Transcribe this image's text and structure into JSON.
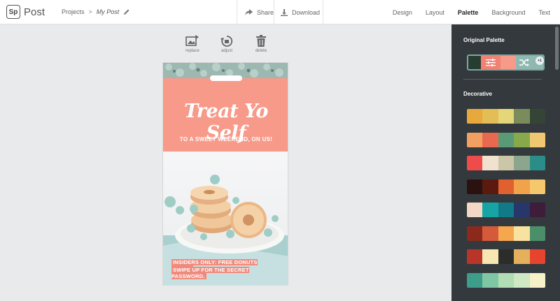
{
  "app": {
    "logo_mark": "Sp",
    "name": "Post"
  },
  "breadcrumb": {
    "projects": "Projects",
    "separator": ">",
    "current": "My Post"
  },
  "actions": {
    "share": "Share",
    "download": "Download"
  },
  "tabs": [
    {
      "label": "Design",
      "active": false
    },
    {
      "label": "Layout",
      "active": false
    },
    {
      "label": "Palette",
      "active": true
    },
    {
      "label": "Background",
      "active": false
    },
    {
      "label": "Text",
      "active": false
    }
  ],
  "tools": {
    "replace": "replace",
    "adjust": "adjust",
    "delete": "delete"
  },
  "poster": {
    "headline": "Treat Yo Self",
    "subhead": "TO A SWEET WEEKEND, ON US!",
    "caption_line1": "INSIDERS ONLY: FREE DONUTS TODAY!",
    "caption_line2": "SWIPE UP FOR THE SECRET PASSWORD."
  },
  "panel": {
    "original_palette_title": "Original Palette",
    "original_colors": [
      "#283d32",
      "#ef8273",
      "#f79a8a",
      "#f79a8a",
      "#8fb8b3"
    ],
    "badge": "+1",
    "decorative_title": "Decorative",
    "palettes": [
      [
        "#e7a93b",
        "#e3bd55",
        "#e6d67a",
        "#7b8c5c",
        "#354535"
      ],
      [
        "#f1a062",
        "#e8694f",
        "#5a9a77",
        "#87a94b",
        "#f0c871"
      ],
      [
        "#ee4b4b",
        "#f0e2cf",
        "#ccc6a8",
        "#8ba68c",
        "#2a8d88"
      ],
      [
        "#2a1210",
        "#5a1a10",
        "#e0602f",
        "#f1a24a",
        "#f5c86d"
      ],
      [
        "#f4d6c6",
        "#17a4a4",
        "#127a86",
        "#27376b",
        "#3d1d3a"
      ],
      [
        "#8b2a1c",
        "#d55a3c",
        "#f6a74e",
        "#f8e2a0",
        "#4a8f6a"
      ],
      [
        "#b8352a",
        "#f7e6b2",
        "#2b2d2a",
        "#e5b05c",
        "#e6442f"
      ],
      [
        "#3d9c8a",
        "#7fc6a4",
        "#b1dcb4",
        "#cde8c2",
        "#f6f1c9"
      ]
    ]
  }
}
